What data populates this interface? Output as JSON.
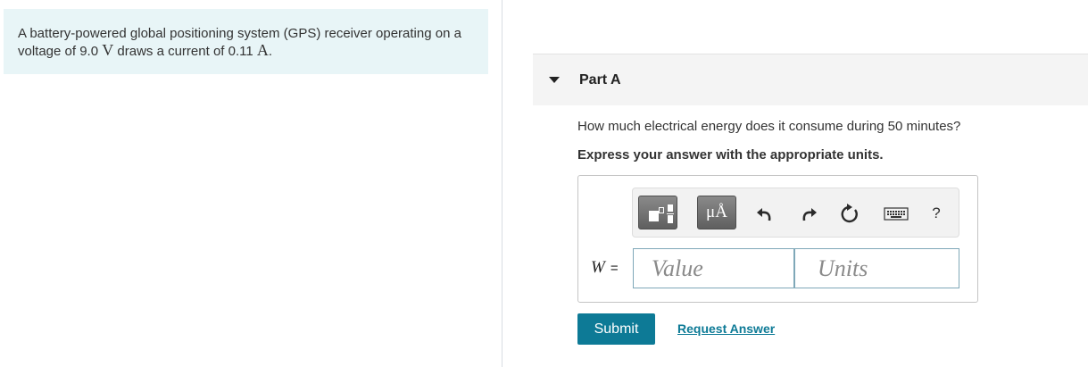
{
  "problem": {
    "text_before_voltage": "A battery-powered global positioning system (GPS) receiver operating on a voltage of 9.0 ",
    "voltage_unit": "V",
    "text_before_current": " draws a current of 0.11 ",
    "current_unit": "A",
    "text_end": "."
  },
  "part": {
    "title": "Part A",
    "question": "How much electrical energy does it consume during 50 minutes?",
    "instruction": "Express your answer with the appropriate units."
  },
  "toolbar": {
    "units_label": "μÅ",
    "help_label": "?",
    "icons": [
      "templates-icon",
      "units-icon",
      "undo-icon",
      "redo-icon",
      "reset-icon",
      "keyboard-icon",
      "help-icon"
    ]
  },
  "answer": {
    "variable": "W",
    "equals": "=",
    "value_placeholder": "Value",
    "units_placeholder": "Units"
  },
  "actions": {
    "submit_label": "Submit",
    "request_label": "Request Answer"
  },
  "colors": {
    "problem_bg": "#e8f5f7",
    "accent": "#0d7a96",
    "header_bg": "#f4f4f4"
  }
}
